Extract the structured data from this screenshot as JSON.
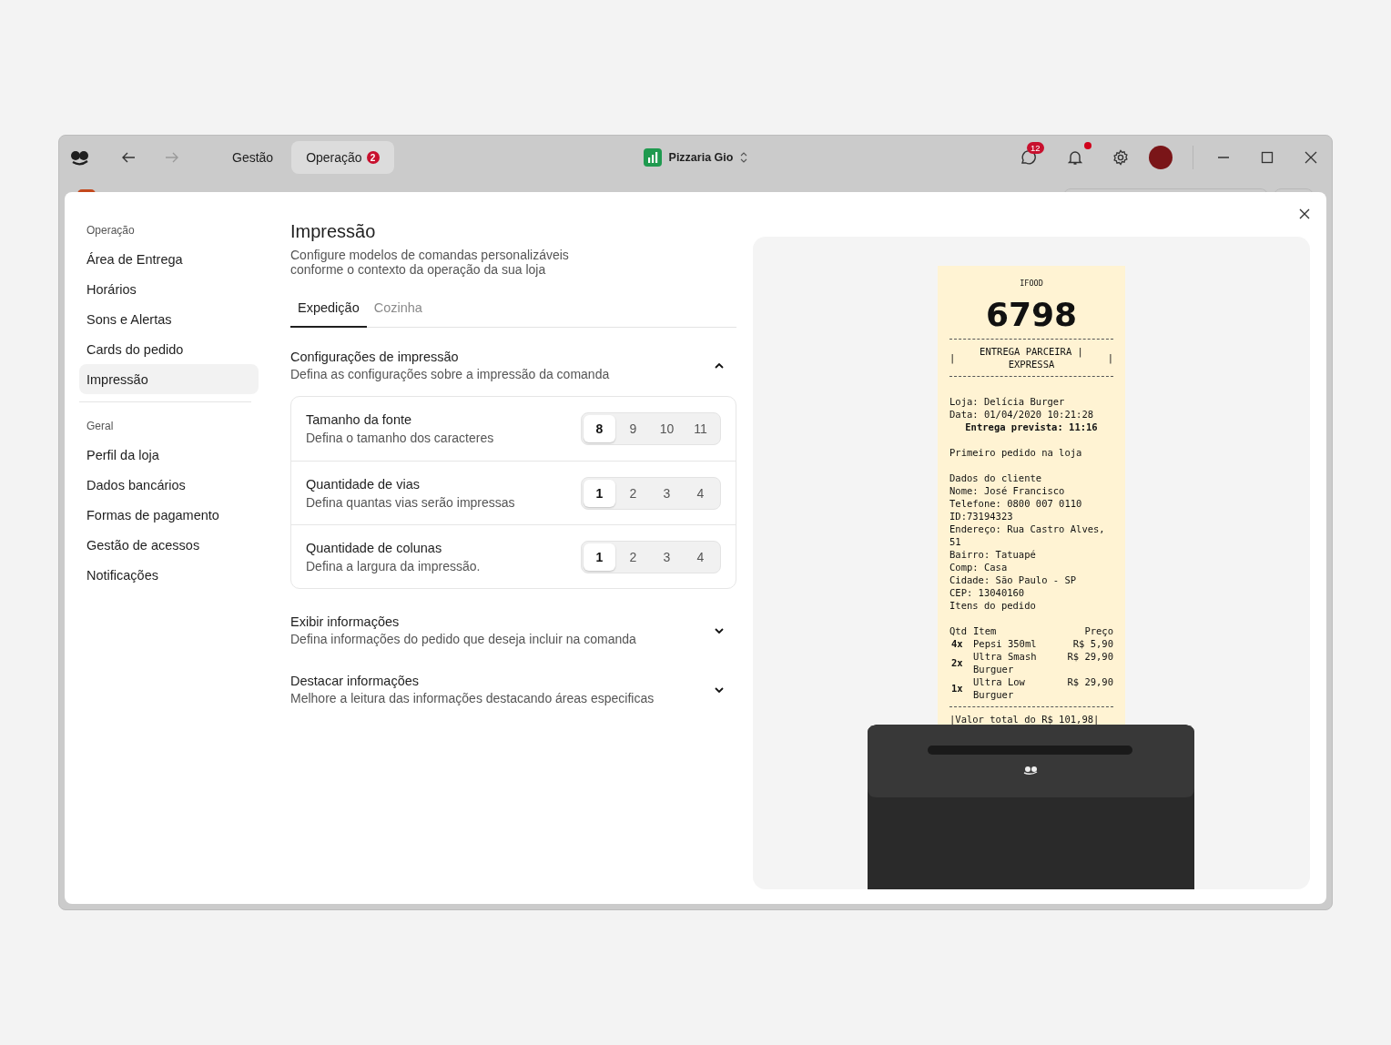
{
  "titlebar": {
    "nav_tabs": [
      {
        "label": "Gestão",
        "selected": false
      },
      {
        "label": "Operação",
        "selected": true,
        "badge": "2"
      }
    ],
    "store": {
      "name": "Pizzaria Gio"
    },
    "chat_badge": "12",
    "bell_dot": true
  },
  "sidebar": {
    "sections": [
      {
        "title": "Operação",
        "items": [
          {
            "label": "Área de Entrega",
            "selected": false
          },
          {
            "label": "Horários",
            "selected": false
          },
          {
            "label": "Sons e Alertas",
            "selected": false
          },
          {
            "label": "Cards do pedido",
            "selected": false
          },
          {
            "label": "Impressão",
            "selected": true
          }
        ]
      },
      {
        "title": "Geral",
        "items": [
          {
            "label": "Perfil da loja",
            "selected": false
          },
          {
            "label": "Dados bancários",
            "selected": false
          },
          {
            "label": "Formas de pagamento",
            "selected": false
          },
          {
            "label": "Gestão de acessos",
            "selected": false
          },
          {
            "label": "Notificações",
            "selected": false
          }
        ]
      }
    ]
  },
  "content": {
    "title": "Impressão",
    "description": "Configure modelos de comandas personalizáveis\nconforme o contexto da operação da sua loja",
    "tabs": [
      {
        "label": "Expedição",
        "selected": true
      },
      {
        "label": "Cozinha",
        "selected": false
      }
    ],
    "sections": [
      {
        "title": "Configurações de impressão",
        "subtitle": "Defina as configurações sobre a impressão da comanda",
        "expanded": true,
        "settings": [
          {
            "label": "Tamanho da fonte",
            "hint": "Defina o tamanho dos caracteres",
            "options": [
              {
                "label": "8",
                "selected": true
              },
              {
                "label": "9",
                "selected": false
              },
              {
                "label": "10",
                "selected": false
              },
              {
                "label": "11",
                "selected": false
              }
            ]
          },
          {
            "label": "Quantidade de vias",
            "hint": "Defina quantas vias serão impressas",
            "options": [
              {
                "label": "1",
                "selected": true
              },
              {
                "label": "2",
                "selected": false
              },
              {
                "label": "3",
                "selected": false
              },
              {
                "label": "4",
                "selected": false
              }
            ]
          },
          {
            "label": "Quantidade de colunas",
            "hint": "Defina a largura da impressão.",
            "options": [
              {
                "label": "1",
                "selected": true
              },
              {
                "label": "2",
                "selected": false
              },
              {
                "label": "3",
                "selected": false
              },
              {
                "label": "4",
                "selected": false
              }
            ]
          }
        ]
      },
      {
        "title": "Exibir informações",
        "subtitle": "Defina informações do pedido que deseja incluir na comanda",
        "expanded": false
      },
      {
        "title": "Destacar informações",
        "subtitle": "Melhore a leitura das informações destacando áreas especificas",
        "expanded": false
      }
    ]
  },
  "receipt": {
    "lines": [
      {
        "kind": "center",
        "text": "IFOOD"
      },
      {
        "kind": "big",
        "text": "6798"
      },
      {
        "kind": "rule"
      },
      {
        "kind": "boxed",
        "text": "ENTREGA PARCEIRA | EXPRESSA",
        "left": "|",
        "right": "|"
      },
      {
        "kind": "rule"
      },
      {
        "kind": "gap"
      },
      {
        "kind": "text",
        "text": "Loja: Delícia Burger"
      },
      {
        "kind": "text",
        "text": "Data: 01/04/2020 10:21:28"
      },
      {
        "kind": "bold",
        "text": "Entrega prevista: 11:16"
      },
      {
        "kind": "gap"
      },
      {
        "kind": "text",
        "text": "Primeiro pedido na loja"
      },
      {
        "kind": "gap"
      },
      {
        "kind": "text",
        "text": "Dados do cliente"
      },
      {
        "kind": "text",
        "text": "Nome: José Francisco"
      },
      {
        "kind": "text",
        "text": "Telefone: 0800 007 0110"
      },
      {
        "kind": "text",
        "text": "ID:73194323"
      },
      {
        "kind": "text",
        "text": "Endereço: Rua Castro Alves,\n51"
      },
      {
        "kind": "text",
        "text": "Bairro: Tatuapé"
      },
      {
        "kind": "text",
        "text": "Comp: Casa"
      },
      {
        "kind": "text",
        "text": "Cidade: São Paulo - SP"
      },
      {
        "kind": "text",
        "text": "CEP: 13040160"
      },
      {
        "kind": "text",
        "text": "Itens do pedido"
      },
      {
        "kind": "gap"
      },
      {
        "kind": "item",
        "qty": "Qtd",
        "name": "Item",
        "price": "Preço"
      },
      {
        "kind": "item",
        "qty": "4x",
        "name": "Pepsi 350ml",
        "price": "R$ 5,90"
      },
      {
        "kind": "item",
        "qty": "2x",
        "name": "Ultra Smash\nBurguer",
        "price": "R$ 29,90"
      },
      {
        "kind": "item",
        "qty": "1x",
        "name": "Ultra Low\nBurguer",
        "price": "R$ 29,90"
      },
      {
        "kind": "rule"
      },
      {
        "kind": "text",
        "text": "|Valor total do   R$ 101,98|"
      }
    ]
  }
}
